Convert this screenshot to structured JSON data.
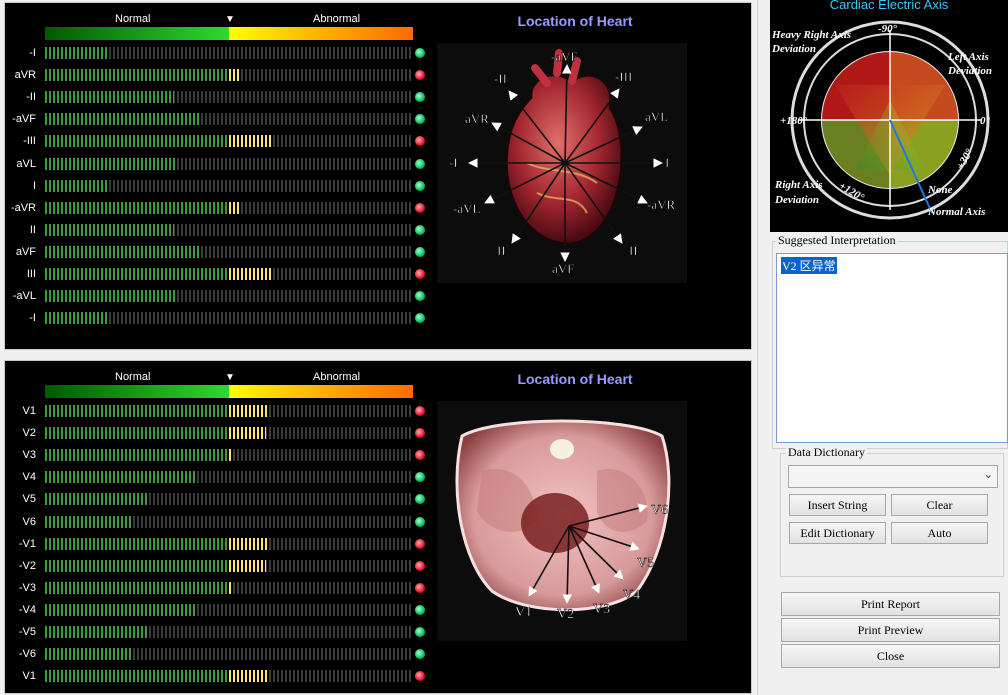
{
  "scale": {
    "normal": "Normal",
    "abnormal": "Abnormal",
    "marker": "▼"
  },
  "limb_panel": {
    "title": "Location of Heart",
    "leads": [
      {
        "lead": "-I",
        "green": 0.17,
        "yellow": 0,
        "status": "green"
      },
      {
        "lead": "aVR",
        "green": 0.5,
        "yellow": 0.03,
        "status": "red"
      },
      {
        "lead": "-II",
        "green": 0.35,
        "yellow": 0,
        "status": "green"
      },
      {
        "lead": "-aVF",
        "green": 0.42,
        "yellow": 0,
        "status": "green"
      },
      {
        "lead": "-III",
        "green": 0.5,
        "yellow": 0.12,
        "status": "red"
      },
      {
        "lead": "aVL",
        "green": 0.36,
        "yellow": 0,
        "status": "green"
      },
      {
        "lead": "I",
        "green": 0.17,
        "yellow": 0,
        "status": "green"
      },
      {
        "lead": "-aVR",
        "green": 0.5,
        "yellow": 0.03,
        "status": "red"
      },
      {
        "lead": "II",
        "green": 0.35,
        "yellow": 0,
        "status": "green"
      },
      {
        "lead": "aVF",
        "green": 0.42,
        "yellow": 0,
        "status": "green"
      },
      {
        "lead": "III",
        "green": 0.5,
        "yellow": 0.12,
        "status": "red"
      },
      {
        "lead": "-aVL",
        "green": 0.36,
        "yellow": 0,
        "status": "green"
      },
      {
        "lead": "-I",
        "green": 0.17,
        "yellow": 0,
        "status": "green"
      }
    ],
    "diagram_labels": {
      "maVF": "-aVF",
      "mII": "-II",
      "mIII": "-III",
      "aVR": "aVR",
      "aVL": "aVL",
      "mI": "-I",
      "I": "I",
      "maVL": "-aVL",
      "maVR": "-aVR",
      "II": "II",
      "aVF": "aVF",
      "III": "II"
    }
  },
  "chest_panel": {
    "title": "Location of Heart",
    "leads": [
      {
        "lead": "V1",
        "green": 0.5,
        "yellow": 0.11,
        "status": "red"
      },
      {
        "lead": "V2",
        "green": 0.5,
        "yellow": 0.1,
        "status": "red"
      },
      {
        "lead": "V3",
        "green": 0.5,
        "yellow": 0.01,
        "status": "red"
      },
      {
        "lead": "V4",
        "green": 0.41,
        "yellow": 0,
        "status": "green"
      },
      {
        "lead": "V5",
        "green": 0.28,
        "yellow": 0,
        "status": "green"
      },
      {
        "lead": "V6",
        "green": 0.24,
        "yellow": 0,
        "status": "green"
      },
      {
        "lead": "-V1",
        "green": 0.5,
        "yellow": 0.11,
        "status": "red"
      },
      {
        "lead": "-V2",
        "green": 0.5,
        "yellow": 0.1,
        "status": "red"
      },
      {
        "lead": "-V3",
        "green": 0.5,
        "yellow": 0.01,
        "status": "red"
      },
      {
        "lead": "-V4",
        "green": 0.41,
        "yellow": 0,
        "status": "green"
      },
      {
        "lead": "-V5",
        "green": 0.28,
        "yellow": 0,
        "status": "green"
      },
      {
        "lead": "-V6",
        "green": 0.24,
        "yellow": 0,
        "status": "green"
      },
      {
        "lead": "V1",
        "green": 0.5,
        "yellow": 0.11,
        "status": "red"
      }
    ],
    "diagram_labels": {
      "V1": "V1",
      "V2": "V2",
      "V3": "V3",
      "V4": "V4",
      "V5": "V5",
      "V6": "V6"
    }
  },
  "axis": {
    "title": "Cardiac Electric Axis",
    "deg_m90": "-90°",
    "deg_180": "+180°",
    "deg_0": "0°",
    "deg_30": "+30°",
    "deg_120": "+120°",
    "heavy_right_1": "Heavy Right Axis",
    "heavy_right_2": "Deviation",
    "left_1": "Left Axis",
    "left_2": "Deviation",
    "right_1": "Right Axis",
    "right_2": "Deviation",
    "none": "None",
    "normal": "Normal Axis"
  },
  "interpretation": {
    "label": "Suggested Interpretation",
    "text": "V2 区异常"
  },
  "dictionary": {
    "label": "Data Dictionary",
    "selected": "",
    "insert": "Insert String",
    "clear": "Clear",
    "edit": "Edit Dictionary",
    "auto": "Auto"
  },
  "actions": {
    "print_report": "Print Report",
    "print_preview": "Print Preview",
    "close": "Close"
  },
  "colors": {
    "normal_green": "#2fd92f",
    "abnormal_yellow": "#ffe36a",
    "status_red": "#e8102a",
    "status_green": "#00c060",
    "title_blue": "#9a9aff",
    "axis_title": "#3cc8ff"
  }
}
